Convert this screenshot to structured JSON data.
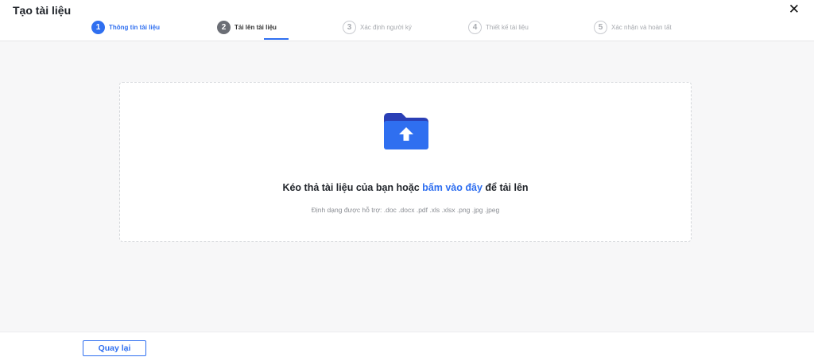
{
  "header": {
    "title": "Tạo tài liệu",
    "close_symbol": "✕",
    "close_icon": "close-icon"
  },
  "steps": [
    {
      "number": "1",
      "label": "Thông tin tài liệu",
      "state": "completed"
    },
    {
      "number": "2",
      "label": "Tải lên tài liệu",
      "state": "current"
    },
    {
      "number": "3",
      "label": "Xác định người ký",
      "state": "pending"
    },
    {
      "number": "4",
      "label": "Thiết kế tài liệu",
      "state": "pending"
    },
    {
      "number": "5",
      "label": "Xác nhận và hoàn tất",
      "state": "pending"
    }
  ],
  "upload": {
    "icon": "folder-upload-icon",
    "text_before": "Kéo thả tài liệu của bạn hoặc ",
    "link_text": "bấm vào đây",
    "text_after": " để tải lên",
    "formats": "Định dạng được hỗ trợ: .doc .docx .pdf .xls .xlsx .png .jpg .jpeg"
  },
  "footer": {
    "back_label": "Quay lại"
  },
  "colors": {
    "accent": "#2f6ff0",
    "folder_back": "#2a3fb6",
    "folder_front": "#2f6ff0",
    "step_current": "#6b6e75",
    "step_pending": "#a6a9ae",
    "background": "#f7f7f8"
  }
}
